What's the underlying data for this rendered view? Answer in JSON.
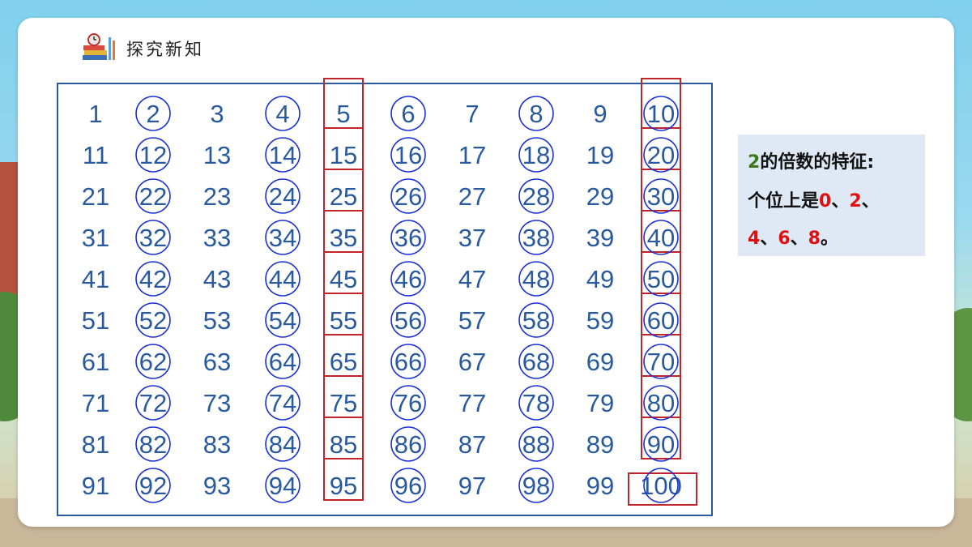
{
  "header": {
    "title": "探究新知",
    "icon": "stationery-books-icon"
  },
  "grid": {
    "numbers": [
      1,
      2,
      3,
      4,
      5,
      6,
      7,
      8,
      9,
      10,
      11,
      12,
      13,
      14,
      15,
      16,
      17,
      18,
      19,
      20,
      21,
      22,
      23,
      24,
      25,
      26,
      27,
      28,
      29,
      30,
      31,
      32,
      33,
      34,
      35,
      36,
      37,
      38,
      39,
      40,
      41,
      42,
      43,
      44,
      45,
      46,
      47,
      48,
      49,
      50,
      51,
      52,
      53,
      54,
      55,
      56,
      57,
      58,
      59,
      60,
      61,
      62,
      63,
      64,
      65,
      66,
      67,
      68,
      69,
      70,
      71,
      72,
      73,
      74,
      75,
      76,
      77,
      78,
      79,
      80,
      81,
      82,
      83,
      84,
      85,
      86,
      87,
      88,
      89,
      90,
      91,
      92,
      93,
      94,
      95,
      96,
      97,
      98,
      99,
      100
    ],
    "circled": "even numbers (multiples of 2)",
    "boxed_columns": [
      5,
      10
    ],
    "circle_color": "#1a2fd6",
    "box_color": "#c0232a",
    "text_color": "#2a5a9e"
  },
  "info": {
    "line1_num": "2",
    "line1_text": "的倍数的特征:",
    "line2_text": "个位上是",
    "d0": "0",
    "d2": "2",
    "d4": "4",
    "d6": "6",
    "d8": "8",
    "sep": "、",
    "end": "。"
  }
}
